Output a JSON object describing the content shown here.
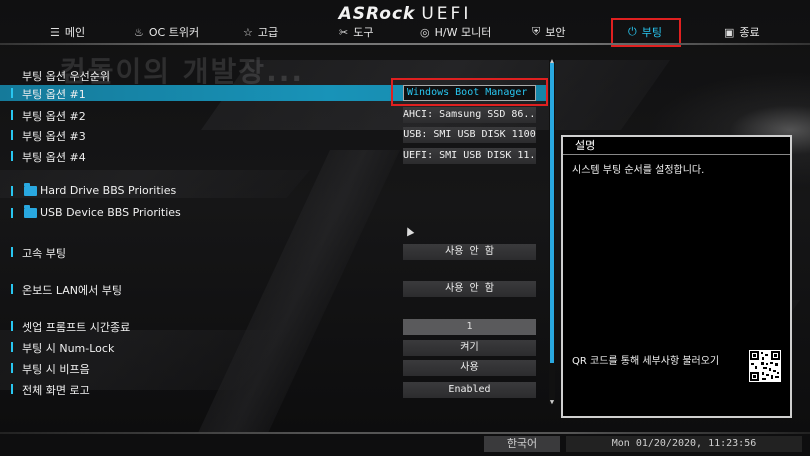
{
  "header": {
    "brand": "ASRock",
    "product": "UEFI"
  },
  "tabs": [
    {
      "label": "메인",
      "icon": "list-icon"
    },
    {
      "label": "OC 트위커",
      "icon": "flame-icon"
    },
    {
      "label": "고급",
      "icon": "star-icon"
    },
    {
      "label": "도구",
      "icon": "tools-icon"
    },
    {
      "label": "H/W 모니터",
      "icon": "monitor-icon"
    },
    {
      "label": "보안",
      "icon": "shield-icon"
    },
    {
      "label": "부팅",
      "icon": "power-icon"
    },
    {
      "label": "종료",
      "icon": "exit-icon"
    }
  ],
  "active_tab": "부팅",
  "watermark": "컴돌이의 개발장...",
  "section_title": "부팅 옵션 우선순위",
  "boot_options": [
    {
      "label": "부팅 옵션 #1",
      "value": "Windows Boot Manager ..."
    },
    {
      "label": "부팅 옵션 #2",
      "value": "AHCI:  Samsung SSD 86..."
    },
    {
      "label": "부팅 옵션 #3",
      "value": "USB: SMI USB DISK 1100"
    },
    {
      "label": "부팅 옵션 #4",
      "value": "UEFI: SMI USB DISK 11..."
    }
  ],
  "priorities": [
    {
      "label": "Hard Drive BBS Priorities"
    },
    {
      "label": "USB Device BBS Priorities"
    }
  ],
  "settings": [
    {
      "label": "고속 부팅",
      "value": "사용 안 함"
    },
    {
      "label": "온보드 LAN에서 부팅",
      "value": "사용 안 함"
    },
    {
      "label": "셋업 프롬프트 시간종료",
      "value": "1"
    },
    {
      "label": "부팅 시 Num-Lock",
      "value": "켜기"
    },
    {
      "label": "부팅 시 비프음",
      "value": "사용"
    },
    {
      "label": "전체 화면 로고",
      "value": "Enabled"
    }
  ],
  "help_panel": {
    "title": "설명",
    "text": "시스템 부팅 순서를 설정합니다.",
    "qr_text": "QR 코드를 통해 세부사항 불러오기"
  },
  "footer": {
    "language": "한국어",
    "datetime": "Mon 01/20/2020, 11:23:56"
  },
  "colors": {
    "accent": "#29c6f0",
    "selection": "#1893b8",
    "highlight_box": "#e02020"
  }
}
